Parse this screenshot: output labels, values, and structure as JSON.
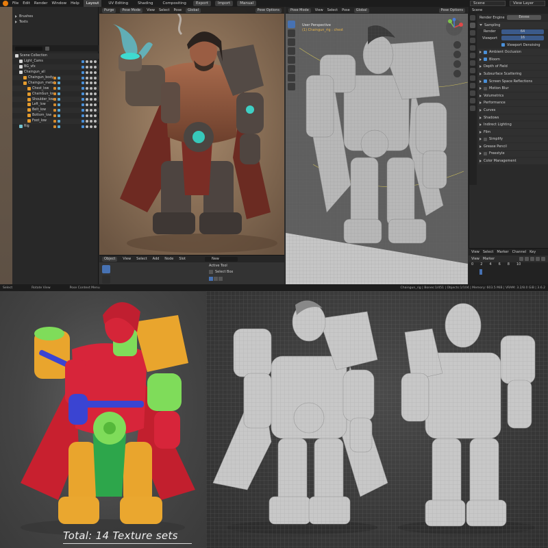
{
  "topbar": {
    "menus": [
      "File",
      "Edit",
      "Render",
      "Window",
      "Help"
    ],
    "workspaces": [
      "Layout",
      "UV Editing",
      "Shading",
      "Compositing"
    ],
    "active_workspace": "Layout",
    "buttons": [
      "Export",
      "Import",
      "Manual"
    ],
    "scene": "Scene",
    "view_layer": "View Layer"
  },
  "outliner": {
    "top_rows": [
      "Brushes",
      "Texts"
    ],
    "tree": [
      {
        "label": "Scene Collection",
        "indent": 0,
        "icon": "coll"
      },
      {
        "label": "Light_Cams",
        "indent": 1,
        "icon": "coll"
      },
      {
        "label": "BG_vfx",
        "indent": 1,
        "icon": "coll"
      },
      {
        "label": "Chaingun_all",
        "indent": 1,
        "icon": "coll"
      },
      {
        "label": "Chaingun_body",
        "indent": 2,
        "icon": "mesh"
      },
      {
        "label": "Chaingun_metal",
        "indent": 2,
        "icon": "mesh"
      },
      {
        "label": "Chest_low",
        "indent": 3,
        "icon": "mesh"
      },
      {
        "label": "ChainGun_low",
        "indent": 3,
        "icon": "mesh"
      },
      {
        "label": "Shoulder_low",
        "indent": 3,
        "icon": "mesh"
      },
      {
        "label": "Left_low",
        "indent": 3,
        "icon": "mesh"
      },
      {
        "label": "Belt_low",
        "indent": 3,
        "icon": "mesh"
      },
      {
        "label": "Bottom_low",
        "indent": 3,
        "icon": "mesh"
      },
      {
        "label": "Foot_low",
        "indent": 3,
        "icon": "mesh"
      },
      {
        "label": "Rig",
        "indent": 1,
        "icon": "arm"
      }
    ]
  },
  "render_view": {
    "header": [
      "Purge",
      "Pose Mode",
      "View",
      "Select",
      "Pose",
      "Global"
    ],
    "right": "Pose Options"
  },
  "wire_view": {
    "header": [
      "Pose Mode",
      "View",
      "Select",
      "Pose",
      "Global"
    ],
    "right": "Pose Options",
    "label": "User Perspective",
    "sublabel": "(1) Chaingun_rig : chest"
  },
  "properties": {
    "title": "Scene",
    "engine_label": "Render Engine",
    "engine_value": "Eevee",
    "sampling": "Sampling",
    "render_label": "Render",
    "render_value": "64",
    "viewport_label": "Viewport",
    "viewport_value": "16",
    "viewport_denoising": "Viewport Denoising",
    "sections": [
      {
        "label": "Ambient Occlusion",
        "checkbox": true
      },
      {
        "label": "Bloom",
        "checkbox": true
      },
      {
        "label": "Depth of Field",
        "checkbox": null
      },
      {
        "label": "Subsurface Scattering",
        "checkbox": null
      },
      {
        "label": "Screen Space Reflections",
        "checkbox": true
      },
      {
        "label": "Motion Blur",
        "checkbox": false
      },
      {
        "label": "Volumetrics",
        "checkbox": null
      },
      {
        "label": "Performance",
        "checkbox": null
      },
      {
        "label": "Curves",
        "checkbox": null
      },
      {
        "label": "Shadows",
        "checkbox": null
      },
      {
        "label": "Indirect Lighting",
        "checkbox": null
      },
      {
        "label": "Film",
        "checkbox": null
      },
      {
        "label": "Simplify",
        "checkbox": false
      },
      {
        "label": "Grease Pencil",
        "checkbox": null
      },
      {
        "label": "Freestyle",
        "checkbox": false
      },
      {
        "label": "Color Management",
        "checkbox": null
      }
    ]
  },
  "timeline": {
    "menus": [
      "View",
      "Select",
      "Marker",
      "Channel",
      "Key"
    ],
    "menus2": [
      "View",
      "Marker"
    ],
    "frame_labels": [
      "0",
      "2",
      "4",
      "6",
      "8",
      "10"
    ]
  },
  "node_panel": {
    "header": [
      "Object",
      "View",
      "Select",
      "Add",
      "Node"
    ],
    "slot": "Slot",
    "new_label": "New",
    "active_tool": "Active Tool",
    "select_box": "Select Box"
  },
  "status": {
    "left": [
      "Select",
      "Rotate View",
      "Pose Context Menu"
    ],
    "right": "Chaingun_rig | Bones:1/451 | Objects:1/104 | Memory: 603.5 MiB | VRAM: 3.2/8.0 GiB | 3.6.2"
  },
  "caption": "Total: 14 Texture sets",
  "colors": {
    "blender_dark": "#2b2b2b",
    "accent_blue": "#4772b3",
    "render_bg": "#8c7058",
    "tex_red": "#d9263c",
    "tex_yellow": "#e8a62e",
    "tex_green": "#7ed957",
    "tex_blue": "#3a45d0",
    "mesh_gray": "#c9c9c9"
  }
}
